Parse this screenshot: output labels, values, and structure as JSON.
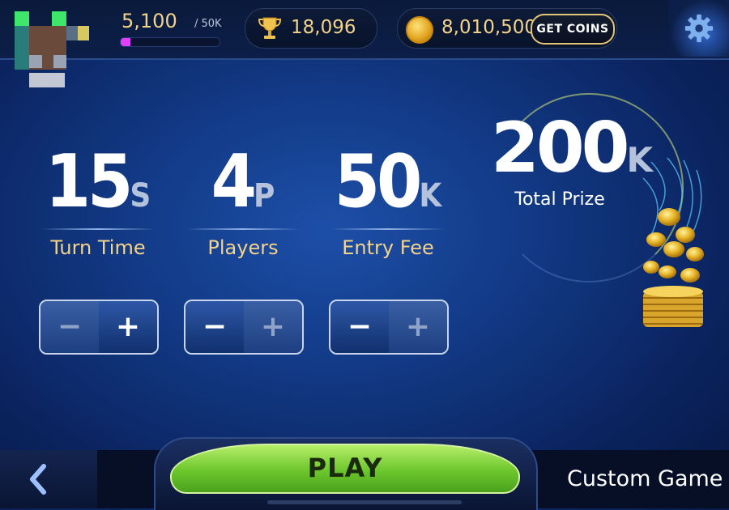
{
  "top_bar": {
    "xp_value": "5,100",
    "xp_max": "/ 50K",
    "xp_fraction": 0.1,
    "trophies": "18,096",
    "coins": "8,010,500",
    "get_coins_label": "GET COINS"
  },
  "settings": [
    {
      "value": "15",
      "unit": "S",
      "label": "Turn Time",
      "minus_enabled": false,
      "plus_enabled": true
    },
    {
      "value": "4",
      "unit": "P",
      "label": "Players",
      "minus_enabled": true,
      "plus_enabled": false
    },
    {
      "value": "50",
      "unit": "K",
      "label": "Entry Fee",
      "minus_enabled": true,
      "plus_enabled": false
    }
  ],
  "prize": {
    "value": "200",
    "unit": "K",
    "label": "Total Prize"
  },
  "bottom": {
    "play_label": "PLAY",
    "title": "Custom Game"
  },
  "icons": [
    "avatar",
    "trophy-icon",
    "coin-icon",
    "gear-icon",
    "back-icon",
    "minus-icon",
    "plus-icon",
    "coins-pile"
  ],
  "colors": {
    "gold": "#f3d38a",
    "play_green": "#6cc62c",
    "background": "#123a86",
    "xp_fill": "#e040fb"
  }
}
